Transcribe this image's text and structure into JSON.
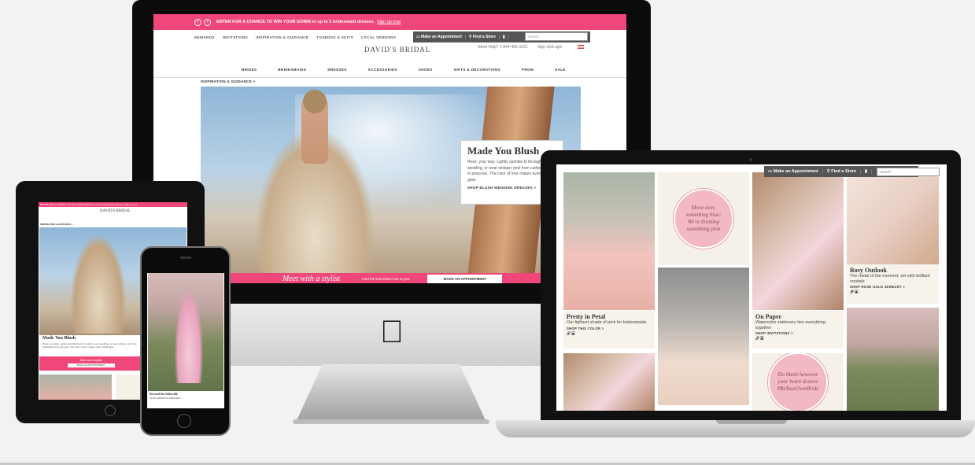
{
  "desktop": {
    "promo": {
      "text": "ENTER FOR A CHANCE TO WIN YOUR GOWN or up to 5 bridesmaid dresses.",
      "link": "Sign up now"
    },
    "utility_nav": [
      "REWARDS",
      "INVITATIONS",
      "INSPIRATION & GUIDANCE",
      "TUXEDOS & SUITS",
      "LOCAL VENDORS"
    ],
    "appointment_label": "Make an Appointment",
    "store_label": "Find a Store",
    "search_placeholder": "search",
    "logo": "DAVID'S BRIDAL",
    "help": "Need Help? 1-844-400-3222",
    "signin": "Sign Up/Login",
    "main_nav": [
      "BRIDES",
      "BRIDESMAIDS",
      "DRESSES",
      "ACCESSORIES",
      "SHOES",
      "GIFTS & DECORATIONS",
      "PROM",
      "SALE"
    ],
    "breadcrumb": "INSPIRATION & GUIDANCE >",
    "hero_card": {
      "title": "Made You Blush",
      "body": "Rosé, your way: Lightly sprinkle bl throughout your wedding, or wear whisper pink from cathedral veil to peep-toe. The color of love makes every detail glow.",
      "cta": "SHOP BLUSH WEDDING DRESSES >"
    },
    "stylist": {
      "title": "Meet with a stylist",
      "subtitle": "Find the look that's true to you.",
      "button": "MAKE AN APPOINTMENT"
    }
  },
  "laptop": {
    "appointment_label": "Make an Appointment",
    "store_label": "Find a Store",
    "search_placeholder": "search",
    "circle1": "Move over, something blue: We're thinking something pink",
    "circle2": "Do blush however your heart desires #BeYourOwnBride",
    "tiles": [
      {
        "title": "Pretty in Petal",
        "body": "Our lightest shade of pink for bridesmaids",
        "cta": "SHOP THIS COLOR >",
        "social": "𝒫 ▣"
      },
      {
        "title": "On Paper",
        "body": "Watercolor stationery ties everything together",
        "cta": "SHOP INVITATIONS >",
        "social": "𝒫 ▣"
      },
      {
        "title": "Rosy Outlook",
        "body": "The metal of the moment, set with brilliant crystals",
        "cta": "SHOP ROSE GOLD JEWELRY >",
        "social": "𝒫 ▣"
      }
    ]
  },
  "tablet": {
    "promo": "ENTER FOR A CHANCE TO WIN YOUR GOWN or up to 5 bridesmaid dresses. Sign up now",
    "logo": "DAVID'S BRIDAL",
    "breadcrumb": "INSPIRATION & GUIDANCE >",
    "title": "Made You Blush",
    "body": "Rosé, your way: Lightly sprinkle blush throughout your wedding, or wear whisper pink from cathedral veil to peep-toe. The color of love makes every detail glow.",
    "stylist": "Meet with a stylist",
    "button": "MAKE AN APPOINTMENT"
  },
  "phone": {
    "caption": "Beyond the Sidewalk",
    "body": "SHOP WEDDING DRESSES >"
  },
  "colors": {
    "brand_pink": "#f0477a",
    "device_black": "#0c0c0c"
  }
}
